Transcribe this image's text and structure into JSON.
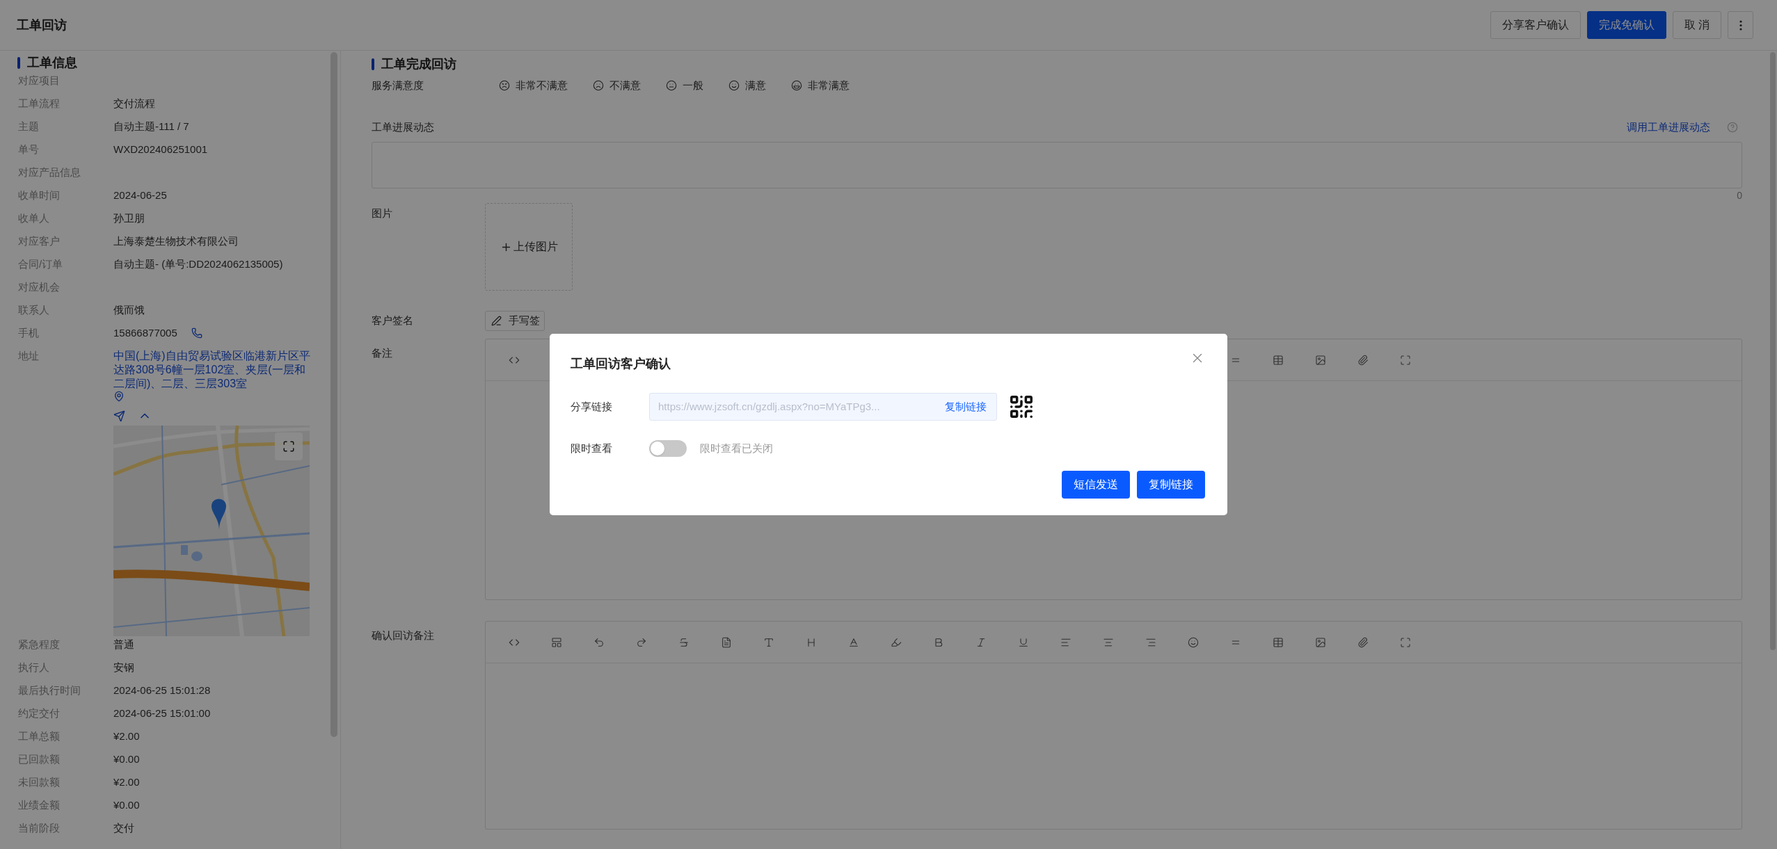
{
  "page": {
    "title": "工单回访"
  },
  "header_buttons": [
    {
      "label": "分享客户确认",
      "kind": "default"
    },
    {
      "label": "完成免确认",
      "kind": "primary"
    },
    {
      "label": "取 消",
      "kind": "default"
    }
  ],
  "info_panel": {
    "title": "工单信息",
    "fields": [
      {
        "label": "对应项目",
        "kind": "text"
      },
      {
        "label": "工单流程",
        "value": "交付流程",
        "kind": "text"
      },
      {
        "label": "主题",
        "value": "自动主题-111 / 7",
        "kind": "text"
      },
      {
        "label": "单号",
        "value": "WXD202406251001",
        "kind": "text"
      },
      {
        "label": "对应产品信息",
        "kind": "text"
      },
      {
        "label": "收单时间",
        "value": "2024-06-25",
        "kind": "text"
      },
      {
        "label": "收单人",
        "value": "孙卫朋",
        "kind": "text"
      },
      {
        "label": "对应客户",
        "value": "上海泰楚生物技术有限公司",
        "kind": "text"
      },
      {
        "label": "合同/订单",
        "value": "自动主题- (单号:DD2024062135005)",
        "kind": "text"
      },
      {
        "label": "对应机会",
        "kind": "text"
      },
      {
        "label": "联系人",
        "value": "俄而饿",
        "kind": "text"
      },
      {
        "label": "手机",
        "value": "15866877005",
        "kind": "phone"
      },
      {
        "label": "地址",
        "value": "中国(上海)自由贸易试验区临港新片区平达路308号6幢一层102室、夹层(一层和二层间)、二层、三层303室",
        "kind": "address"
      }
    ],
    "fields_after_map": [
      {
        "label": "紧急程度",
        "value": "普通",
        "kind": "text"
      },
      {
        "label": "执行人",
        "value": "安钢",
        "kind": "text"
      },
      {
        "label": "最后执行时间",
        "value": "2024-06-25 15:01:28",
        "kind": "text"
      },
      {
        "label": "约定交付",
        "value": "2024-06-25 15:01:00",
        "kind": "text"
      },
      {
        "label": "工单总额",
        "value": "¥2.00",
        "kind": "text"
      },
      {
        "label": "已回款额",
        "value": "¥0.00",
        "kind": "text"
      },
      {
        "label": "未回款额",
        "value": "¥2.00",
        "kind": "text"
      },
      {
        "label": "业绩金额",
        "value": "¥0.00",
        "kind": "text"
      },
      {
        "label": "当前阶段",
        "value": "交付",
        "kind": "text"
      }
    ]
  },
  "visit_form": {
    "title": "工单完成回访",
    "satisfaction": {
      "label": "服务满意度",
      "options": [
        {
          "label": "非常不满意",
          "selected": false
        },
        {
          "label": "不满意",
          "selected": false
        },
        {
          "label": "一般",
          "selected": false
        },
        {
          "label": "满意",
          "selected": false
        },
        {
          "label": "非常满意",
          "selected": false
        }
      ]
    },
    "progress": {
      "label": "工单进展动态",
      "link": "调用工单进展动态",
      "count": "0"
    },
    "images": {
      "label": "图片",
      "upload": "上传图片"
    },
    "signature": {
      "label": "客户签名",
      "button": "手写签"
    },
    "remarks": {
      "label": "备注"
    },
    "confirm_remarks": {
      "label": "确认回访备注"
    }
  },
  "dialog": {
    "title": "工单回访客户确认",
    "share_link": {
      "label": "分享链接",
      "value": "https://www.jzsoft.cn/gzdlj.aspx?no=MYaTPg3...",
      "action": "复制链接"
    },
    "time_limit": {
      "label": "限时查看",
      "on": false,
      "status": "限时查看已关闭"
    },
    "buttons": [
      "短信发送",
      "复制链接"
    ]
  }
}
